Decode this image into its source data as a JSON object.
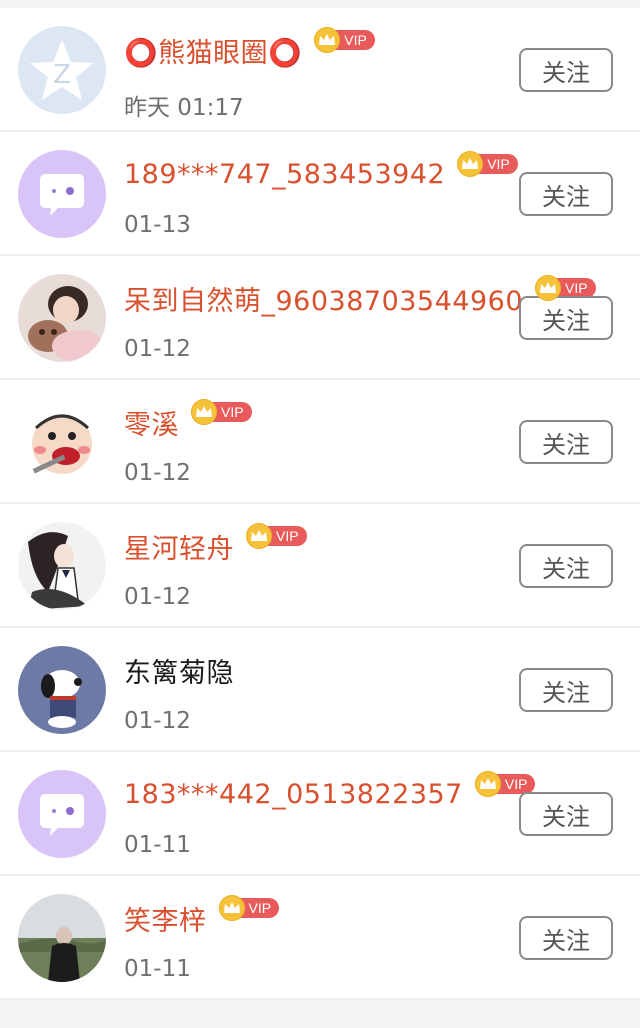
{
  "users": [
    {
      "name": "⭕熊猫眼圈⭕",
      "time": "昨天 01:17",
      "vip": true,
      "vip_label": "VIP",
      "follow_label": "关注",
      "avatar": "qq-star-avatar"
    },
    {
      "name": "189***747_583453942",
      "time": "01-13",
      "vip": true,
      "vip_label": "VIP",
      "follow_label": "关注",
      "avatar": "chat-bubble-avatar"
    },
    {
      "name": "呆到自然萌_96038703544960",
      "time": "01-12",
      "vip": true,
      "vip_label": "VIP",
      "follow_label": "关注",
      "avatar": "girl-with-bear-avatar"
    },
    {
      "name": "零溪",
      "time": "01-12",
      "vip": true,
      "vip_label": "VIP",
      "follow_label": "关注",
      "avatar": "cartoon-boy-avatar"
    },
    {
      "name": "星河轻舟",
      "time": "01-12",
      "vip": true,
      "vip_label": "VIP",
      "follow_label": "关注",
      "avatar": "anime-girl-avatar"
    },
    {
      "name": "东篱菊隐",
      "time": "01-12",
      "vip": false,
      "vip_label": "",
      "follow_label": "关注",
      "avatar": "snoopy-avatar"
    },
    {
      "name": "183***442_0513822357",
      "time": "01-11",
      "vip": true,
      "vip_label": "VIP",
      "follow_label": "关注",
      "avatar": "chat-bubble-avatar"
    },
    {
      "name": "笑李梓",
      "time": "01-11",
      "vip": true,
      "vip_label": "VIP",
      "follow_label": "关注",
      "avatar": "landscape-photo-avatar"
    }
  ],
  "colors": {
    "vip_name": "#d9502e",
    "plain_name": "#1a1a1a",
    "vip_tag": "#e95a5a",
    "crown": "#f6c23a"
  }
}
